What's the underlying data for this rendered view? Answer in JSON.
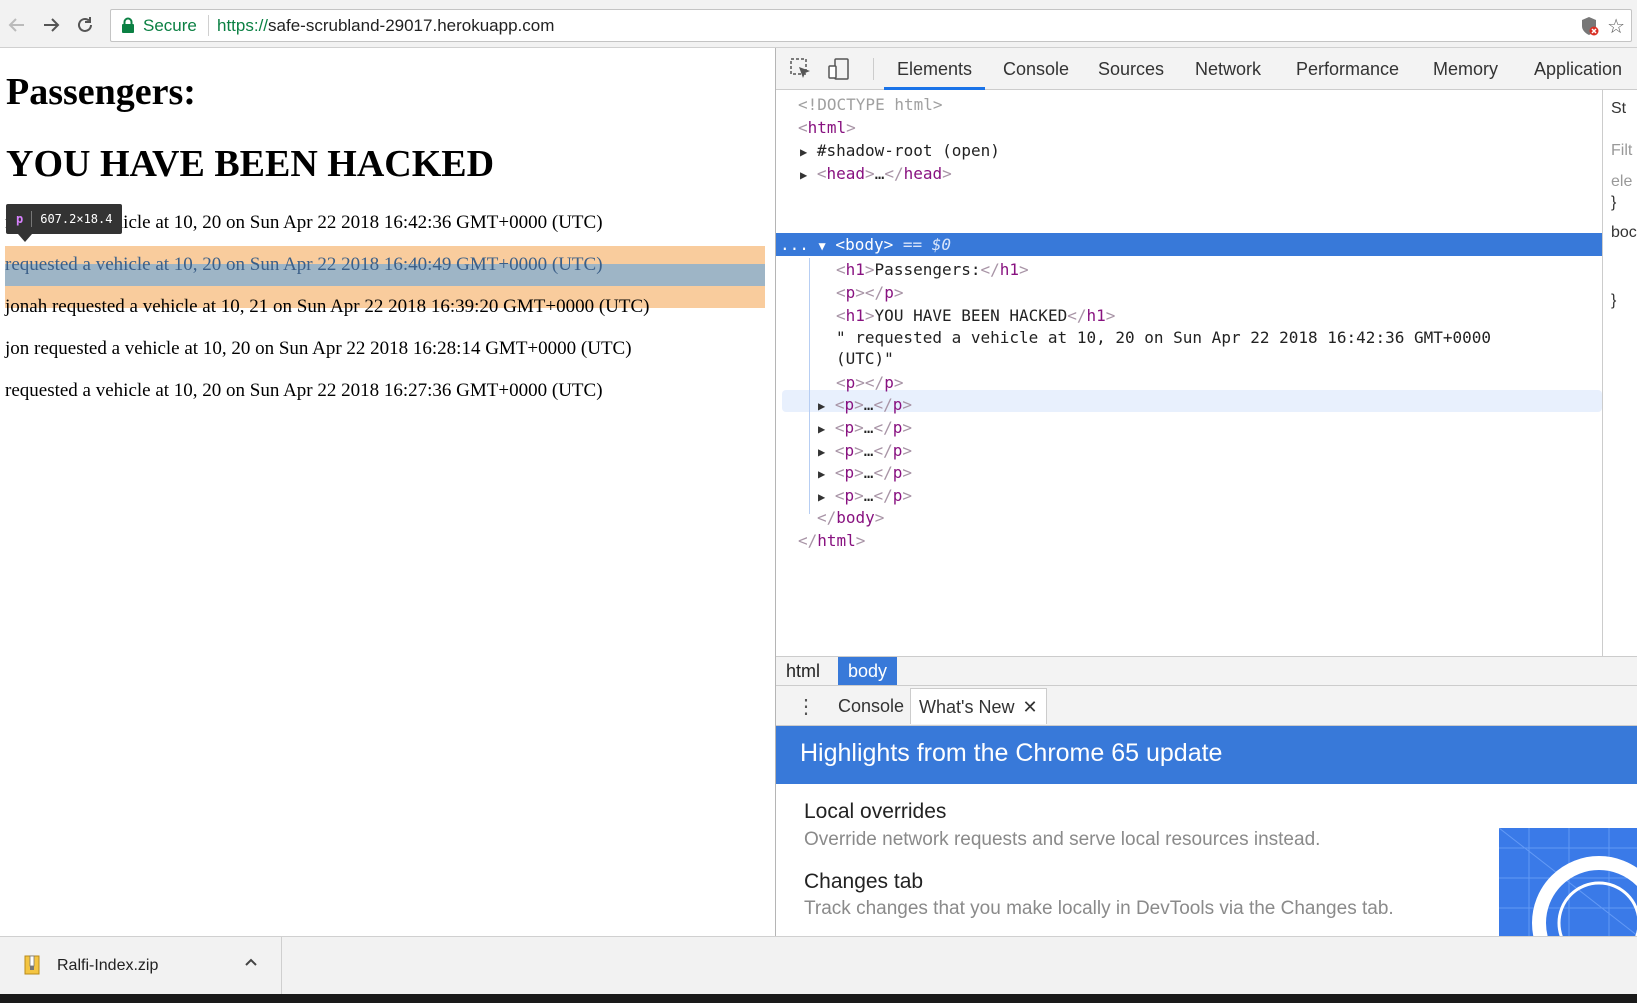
{
  "browser": {
    "secure_label": "Secure",
    "url_scheme": "https://",
    "url_host": "safe-scrubland-29017.herokuapp.com"
  },
  "page": {
    "heading1": "Passengers:",
    "heading2": "YOU HAVE BEEN HACKED",
    "rows": [
      "requested a vehicle at 10, 20 on Sun Apr 22 2018 16:42:36 GMT+0000 (UTC)",
      "requested a vehicle at 10, 20 on Sun Apr 22 2018 16:40:49 GMT+0000 (UTC)",
      "jonah requested a vehicle at 10, 21 on Sun Apr 22 2018 16:39:20 GMT+0000 (UTC)",
      "jon requested a vehicle at 10, 20 on Sun Apr 22 2018 16:28:14 GMT+0000 (UTC)",
      "requested a vehicle at 10, 20 on Sun Apr 22 2018 16:27:36 GMT+0000 (UTC)"
    ],
    "tooltip_tag": "p",
    "tooltip_size": "607.2×18.4"
  },
  "devtools": {
    "tabs": [
      "Elements",
      "Console",
      "Sources",
      "Network",
      "Performance",
      "Memory",
      "Application"
    ],
    "active_tab": "Elements",
    "dom": {
      "doctype": "<!DOCTYPE html>",
      "html_open": "html",
      "shadow_root": "#shadow-root (open)",
      "head": "head",
      "head_ellipsis": "…",
      "body": "body",
      "body_marker": "== $0",
      "h1_first_text": "Passengers:",
      "h1_second_text": "YOU HAVE BEEN HACKED",
      "text_node_line1": "\" requested a vehicle at 10, 20 on Sun Apr 22 2018 16:42:36 GMT+0000",
      "text_node_line2": "(UTC)\"",
      "collapsed_p": "…",
      "body_close": "body",
      "html_close": "html",
      "ellipsis_dots": "..."
    },
    "styles_pane": [
      "St",
      "Filt",
      "ele",
      "}",
      "boc",
      "}"
    ],
    "breadcrumbs": [
      "html",
      "body"
    ],
    "active_crumb": "body",
    "drawer_tabs": [
      "Console",
      "What's New"
    ],
    "active_drawer_tab": "What's New",
    "whats_new": {
      "banner": "Highlights from the Chrome 65 update",
      "items": [
        {
          "title": "Local overrides",
          "desc": "Override network requests and serve local resources instead."
        },
        {
          "title": "Changes tab",
          "desc": "Track changes that you make locally in DevTools via the Changes tab."
        }
      ]
    }
  },
  "downloads": {
    "file_name": "Ralfi-Index.zip"
  },
  "colors": {
    "secure_green": "#0b8043",
    "devtools_blue": "#3879d9",
    "margin_highlight": "#f9cc9d",
    "tag_purple": "#881280"
  }
}
